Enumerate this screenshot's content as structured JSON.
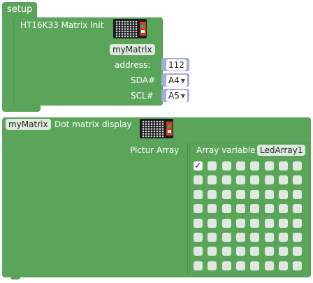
{
  "setup_block": {
    "label": "setup",
    "init": {
      "title": "HT16K33 Matrix Init",
      "instance": "myMatrix",
      "address_label": "address:",
      "address_value": "112",
      "sda_label": "SDA#",
      "sda_value": "A4",
      "scl_label": "SCL#",
      "scl_value": "A5"
    }
  },
  "display_block": {
    "instance": "myMatrix",
    "title": "Dot matrix display",
    "picture_label": "Pictur Array",
    "array_label": "Array variable",
    "array_name": "LedArray1",
    "grid": [
      [
        true,
        false,
        false,
        false,
        false,
        false,
        false,
        false
      ],
      [
        false,
        false,
        false,
        false,
        false,
        false,
        false,
        false
      ],
      [
        false,
        false,
        false,
        false,
        false,
        false,
        false,
        false
      ],
      [
        false,
        false,
        false,
        false,
        false,
        false,
        false,
        false
      ],
      [
        false,
        false,
        false,
        false,
        false,
        false,
        false,
        false
      ],
      [
        false,
        false,
        false,
        false,
        false,
        false,
        false,
        false
      ],
      [
        false,
        false,
        false,
        false,
        false,
        false,
        false,
        false
      ],
      [
        false,
        false,
        false,
        false,
        false,
        false,
        false,
        false
      ]
    ],
    "checkmark": "✓"
  },
  "colors": {
    "block_green": "#5ba55b",
    "value_lavender": "#a6acd9",
    "cell_light": "#dfe9df"
  },
  "icons": [
    "led-matrix-board-icon",
    "dropdown-arrow-icon",
    "checkmark-icon"
  ]
}
